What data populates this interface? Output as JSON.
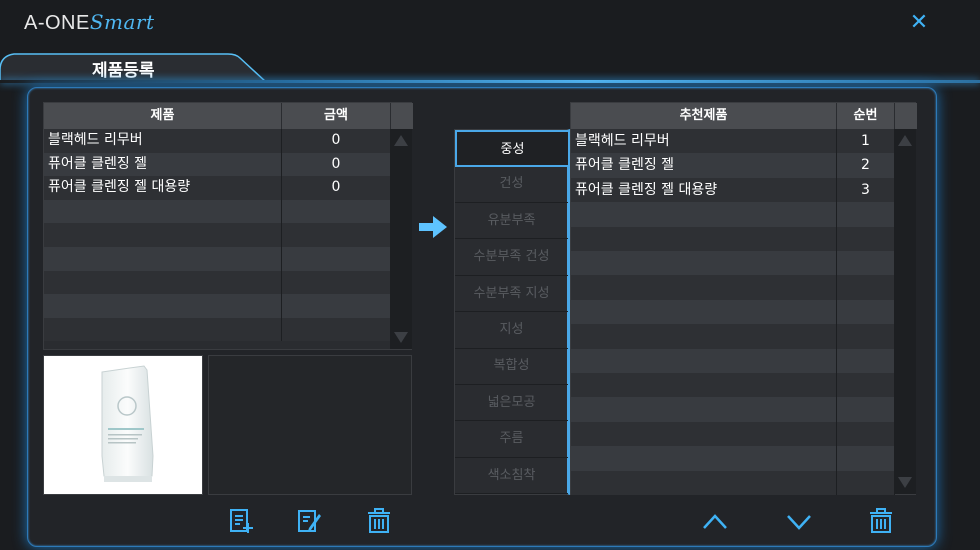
{
  "app": {
    "brand_main": "A-ONE",
    "brand_script": "Smart",
    "close_glyph": "✕"
  },
  "tab": {
    "label": "제품등록"
  },
  "products_table": {
    "headers": [
      "제품",
      "금액"
    ],
    "rows": [
      [
        "블랙헤드 리무버",
        "0"
      ],
      [
        "퓨어클 클렌징 젤",
        "0"
      ],
      [
        "퓨어클 클렌징 젤 대용량",
        "0"
      ],
      [
        "",
        ""
      ],
      [
        "",
        ""
      ],
      [
        "",
        ""
      ],
      [
        "",
        ""
      ],
      [
        "",
        ""
      ],
      [
        "",
        ""
      ]
    ]
  },
  "categories": {
    "items": [
      "중성",
      "건성",
      "유분부족",
      "수분부족 건성",
      "수분부족 지성",
      "지성",
      "복합성",
      "넓은모공",
      "주름",
      "색소침착"
    ],
    "selected": "중성"
  },
  "recommend_table": {
    "headers": [
      "추천제품",
      "순번"
    ],
    "rows": [
      [
        "블랙헤드 리무버",
        "1"
      ],
      [
        "퓨어클 클렌징 젤",
        "2"
      ],
      [
        "퓨어클 클렌징 젤 대용량",
        "3"
      ],
      [
        "",
        ""
      ],
      [
        "",
        ""
      ],
      [
        "",
        ""
      ],
      [
        "",
        ""
      ],
      [
        "",
        ""
      ],
      [
        "",
        ""
      ],
      [
        "",
        ""
      ],
      [
        "",
        ""
      ],
      [
        "",
        ""
      ],
      [
        "",
        ""
      ],
      [
        "",
        ""
      ],
      [
        "",
        ""
      ]
    ]
  },
  "icons": {
    "add": "add-document-icon",
    "edit": "edit-document-icon",
    "delete": "trash-icon",
    "up": "chevron-up-icon",
    "down": "chevron-down-icon",
    "transfer": "arrow-right-icon"
  },
  "colors": {
    "accent": "#4aa8e8",
    "panel_bg": "#222428",
    "header_bg": "#4a4c50"
  }
}
